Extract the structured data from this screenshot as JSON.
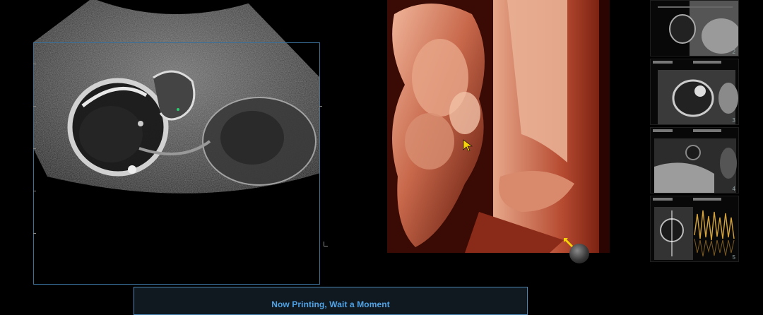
{
  "status": {
    "message": "Now Printing, Wait a Moment",
    "accent_color": "#4fa3e6",
    "frame_color": "#4b86b5"
  },
  "panels": {
    "left_view": "2D B-mode ultrasound image",
    "center_view": "3D surface render (HDlive skin tone)",
    "render_tint": "#c0503a"
  },
  "thumbnails": [
    {
      "index": "2",
      "kind": "B-mode"
    },
    {
      "index": "3",
      "kind": "B-mode"
    },
    {
      "index": "4",
      "kind": "B-mode"
    },
    {
      "index": "5",
      "kind": "Doppler spectrum"
    }
  ],
  "icons": {
    "pointer_1": "yellow-arrow-icon",
    "pointer_2": "yellow-arrow-icon",
    "trackball": "trackball-cursor-icon"
  }
}
